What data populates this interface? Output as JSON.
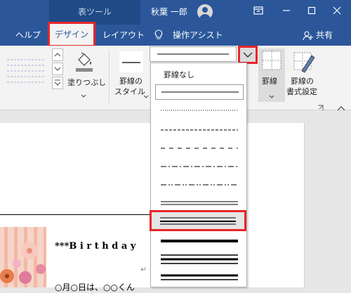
{
  "title_bar": {
    "context_tab": "表ツール",
    "user_name": "秋葉 一郎"
  },
  "ribbon_tabs": [
    "ヘルプ",
    "デザイン",
    "レイアウト",
    "操作アシスト",
    "共有"
  ],
  "active_tab": "デザイン",
  "ribbon": {
    "shading": "塗りつぶし",
    "border_styles_1": "罫線の",
    "border_styles_2": "スタイル",
    "borders": "罫線",
    "border_painter_1": "罫線の",
    "border_painter_2": "書式設定"
  },
  "border_dropdown": {
    "no_border": "罫線なし",
    "options": [
      "single",
      "dotted",
      "dashed",
      "dash-dot",
      "dash-dot-dot",
      "double",
      "thin-thick",
      "thick",
      "triple",
      "thick-thin"
    ],
    "selected": "double"
  },
  "document": {
    "heading": "***B i r t h d a y",
    "paragraph_mark": "↵",
    "body_line": "○月○日は、○○くん"
  },
  "colors": {
    "title_bar": "#2b579a",
    "highlight_red": "#e8262a",
    "ribbon_bg": "#f3f3f3"
  }
}
